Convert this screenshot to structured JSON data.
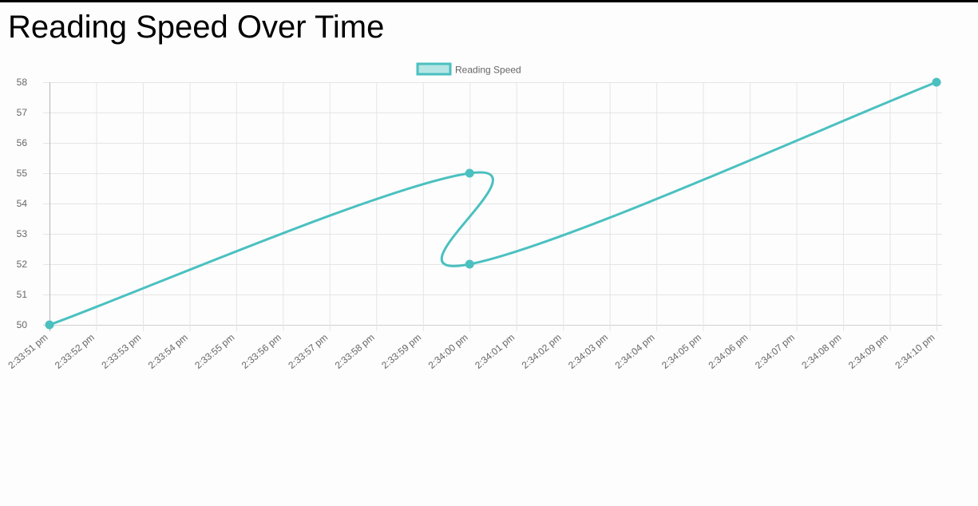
{
  "page": {
    "title": "Reading Speed Over Time"
  },
  "colors": {
    "line": "#4bc0c0",
    "fill": "rgba(75,192,192,0.4)",
    "grid": "#e5e5e5",
    "tick": "#666666"
  },
  "chart_data": {
    "type": "line",
    "title": "",
    "xlabel": "",
    "ylabel": "",
    "legend": {
      "position": "top-center",
      "entries": [
        "Reading Speed"
      ]
    },
    "grid": true,
    "x_ticks": [
      "2:33:51 pm",
      "2:33:52 pm",
      "2:33:53 pm",
      "2:33:54 pm",
      "2:33:55 pm",
      "2:33:56 pm",
      "2:33:57 pm",
      "2:33:58 pm",
      "2:33:59 pm",
      "2:34:00 pm",
      "2:34:01 pm",
      "2:34:02 pm",
      "2:34:03 pm",
      "2:34:04 pm",
      "2:34:05 pm",
      "2:34:06 pm",
      "2:34:07 pm",
      "2:34:08 pm",
      "2:34:09 pm",
      "2:34:10 pm"
    ],
    "y_ticks": [
      50,
      51,
      52,
      53,
      54,
      55,
      56,
      57,
      58
    ],
    "ylim": [
      50,
      58
    ],
    "series": [
      {
        "name": "Reading Speed",
        "x": [
          "2:33:51 pm",
          "2:34:00 pm",
          "2:34:00 pm",
          "2:34:10 pm"
        ],
        "values": [
          50,
          55,
          52,
          58
        ]
      }
    ]
  }
}
